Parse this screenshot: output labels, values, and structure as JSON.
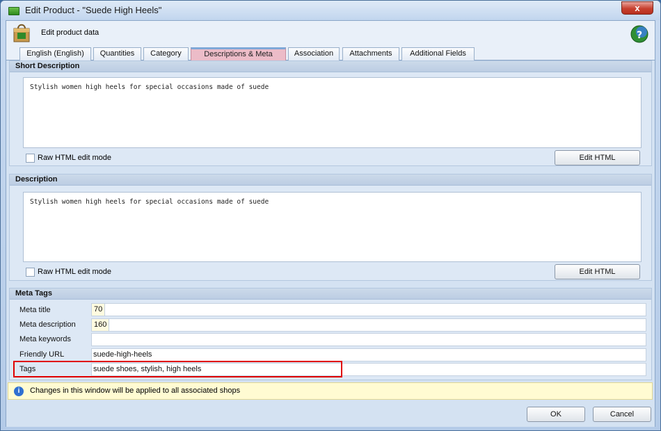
{
  "window": {
    "title": "Edit Product - \"Suede High Heels\"",
    "close_label": "x"
  },
  "header": {
    "text": "Edit product data"
  },
  "tabs": [
    {
      "label": "English (English)",
      "active": false
    },
    {
      "label": "Quantities",
      "active": false
    },
    {
      "label": "Category",
      "active": false
    },
    {
      "label": "Descriptions & Meta",
      "active": true
    },
    {
      "label": "Association",
      "active": false
    },
    {
      "label": "Attachments",
      "active": false
    },
    {
      "label": "Additional Fields",
      "active": false
    }
  ],
  "short_description": {
    "title": "Short Description",
    "text": "Stylish women high heels for special occasions made of suede",
    "raw_html_label": "Raw HTML edit mode",
    "edit_html_label": "Edit HTML"
  },
  "description": {
    "title": "Description",
    "text": "Stylish women high heels for special occasions made of suede",
    "raw_html_label": "Raw HTML edit mode",
    "edit_html_label": "Edit HTML"
  },
  "meta": {
    "title": "Meta Tags",
    "meta_title_label": "Meta title",
    "meta_title_count": "70",
    "meta_title_value": "",
    "meta_description_label": "Meta description",
    "meta_description_count": "160",
    "meta_description_value": "",
    "meta_keywords_label": "Meta keywords",
    "meta_keywords_value": "",
    "friendly_url_label": "Friendly URL",
    "friendly_url_value": "suede-high-heels",
    "tags_label": "Tags",
    "tags_value": "suede shoes, stylish, high heels"
  },
  "info": {
    "icon": "i",
    "text": "Changes in this window will be applied to all associated shops"
  },
  "footer": {
    "ok_label": "OK",
    "cancel_label": "Cancel"
  },
  "colors": {
    "highlight": "#e00000",
    "active_tab": "#ecbcc8"
  }
}
